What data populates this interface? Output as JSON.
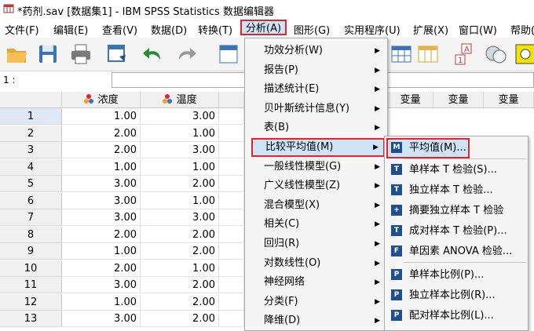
{
  "window": {
    "title": "*药剂.sav [数据集1] - IBM SPSS Statistics 数据编辑器"
  },
  "menubar": [
    {
      "key": "file",
      "label": "文件(F)"
    },
    {
      "key": "edit",
      "label": "编辑(E)"
    },
    {
      "key": "view",
      "label": "查看(V)"
    },
    {
      "key": "data",
      "label": "数据(D)"
    },
    {
      "key": "transform",
      "label": "转换(T)"
    },
    {
      "key": "analyze",
      "label": "分析(A)"
    },
    {
      "key": "graphs",
      "label": "图形(G)"
    },
    {
      "key": "utilities",
      "label": "实用程序(U)"
    },
    {
      "key": "extensions",
      "label": "扩展(X)"
    },
    {
      "key": "window",
      "label": "窗口(W)"
    },
    {
      "key": "help",
      "label": "帮助(H)"
    }
  ],
  "cellbar": {
    "ref": "1 :",
    "value": ""
  },
  "columns": [
    "浓度",
    "温度",
    "变量",
    "变量",
    "变量"
  ],
  "rows": [
    {
      "n": "1",
      "a": "1.00",
      "b": "3.00"
    },
    {
      "n": "2",
      "a": "2.00",
      "b": "1.00"
    },
    {
      "n": "3",
      "a": "2.00",
      "b": "3.00"
    },
    {
      "n": "4",
      "a": "1.00",
      "b": "1.00"
    },
    {
      "n": "5",
      "a": "3.00",
      "b": "2.00"
    },
    {
      "n": "6",
      "a": "3.00",
      "b": "1.00"
    },
    {
      "n": "7",
      "a": "3.00",
      "b": "3.00"
    },
    {
      "n": "8",
      "a": "2.00",
      "b": "2.00"
    },
    {
      "n": "9",
      "a": "1.00",
      "b": "2.00"
    },
    {
      "n": "10",
      "a": "2.00",
      "b": "1.00"
    },
    {
      "n": "11",
      "a": "3.00",
      "b": "2.00"
    },
    {
      "n": "12",
      "a": "1.00",
      "b": "2.00"
    },
    {
      "n": "13",
      "a": "3.00",
      "b": "2.00"
    }
  ],
  "analyze_menu": [
    {
      "label": "功效分析(W)",
      "sub": true
    },
    {
      "label": "报告(P)",
      "sub": true
    },
    {
      "label": "描述统计(E)",
      "sub": true
    },
    {
      "label": "贝叶斯统计信息(Y)",
      "sub": true
    },
    {
      "label": "表(B)",
      "sub": true
    },
    {
      "label": "比较平均值(M)",
      "sub": true,
      "highlight": true
    },
    {
      "label": "一般线性模型(G)",
      "sub": true
    },
    {
      "label": "广义线性模型(Z)",
      "sub": true
    },
    {
      "label": "混合模型(X)",
      "sub": true
    },
    {
      "label": "相关(C)",
      "sub": true
    },
    {
      "label": "回归(R)",
      "sub": true
    },
    {
      "label": "对数线性(O)",
      "sub": true
    },
    {
      "label": "神经网络",
      "sub": true
    },
    {
      "label": "分类(F)",
      "sub": true
    },
    {
      "label": "降维(D)",
      "sub": true
    }
  ],
  "compare_means_menu": [
    {
      "label": "平均值(M)...",
      "icon": "means-icon",
      "highlight": true
    },
    {
      "label": "单样本 T 检验(S)...",
      "icon": "one-sample-t-icon"
    },
    {
      "label": "独立样本 T 检验...",
      "icon": "independent-t-icon"
    },
    {
      "label": "摘要独立样本 T 检验",
      "icon": "summary-t-icon"
    },
    {
      "label": "成对样本 T 检验(P)...",
      "icon": "paired-t-icon"
    },
    {
      "label": "单因素 ANOVA 检验...",
      "icon": "anova-icon"
    },
    {
      "label": "单样本比例(P)...",
      "icon": "one-sample-proportion-icon"
    },
    {
      "label": "独立样本比例(R)...",
      "icon": "independent-proportion-icon"
    },
    {
      "label": "配对样本比例(L)...",
      "icon": "paired-proportion-icon"
    }
  ],
  "colors": {
    "highlight_border": "#e0242a",
    "highlight_fill": "#cde4f7",
    "icon_blue": "#1f4f8f"
  }
}
